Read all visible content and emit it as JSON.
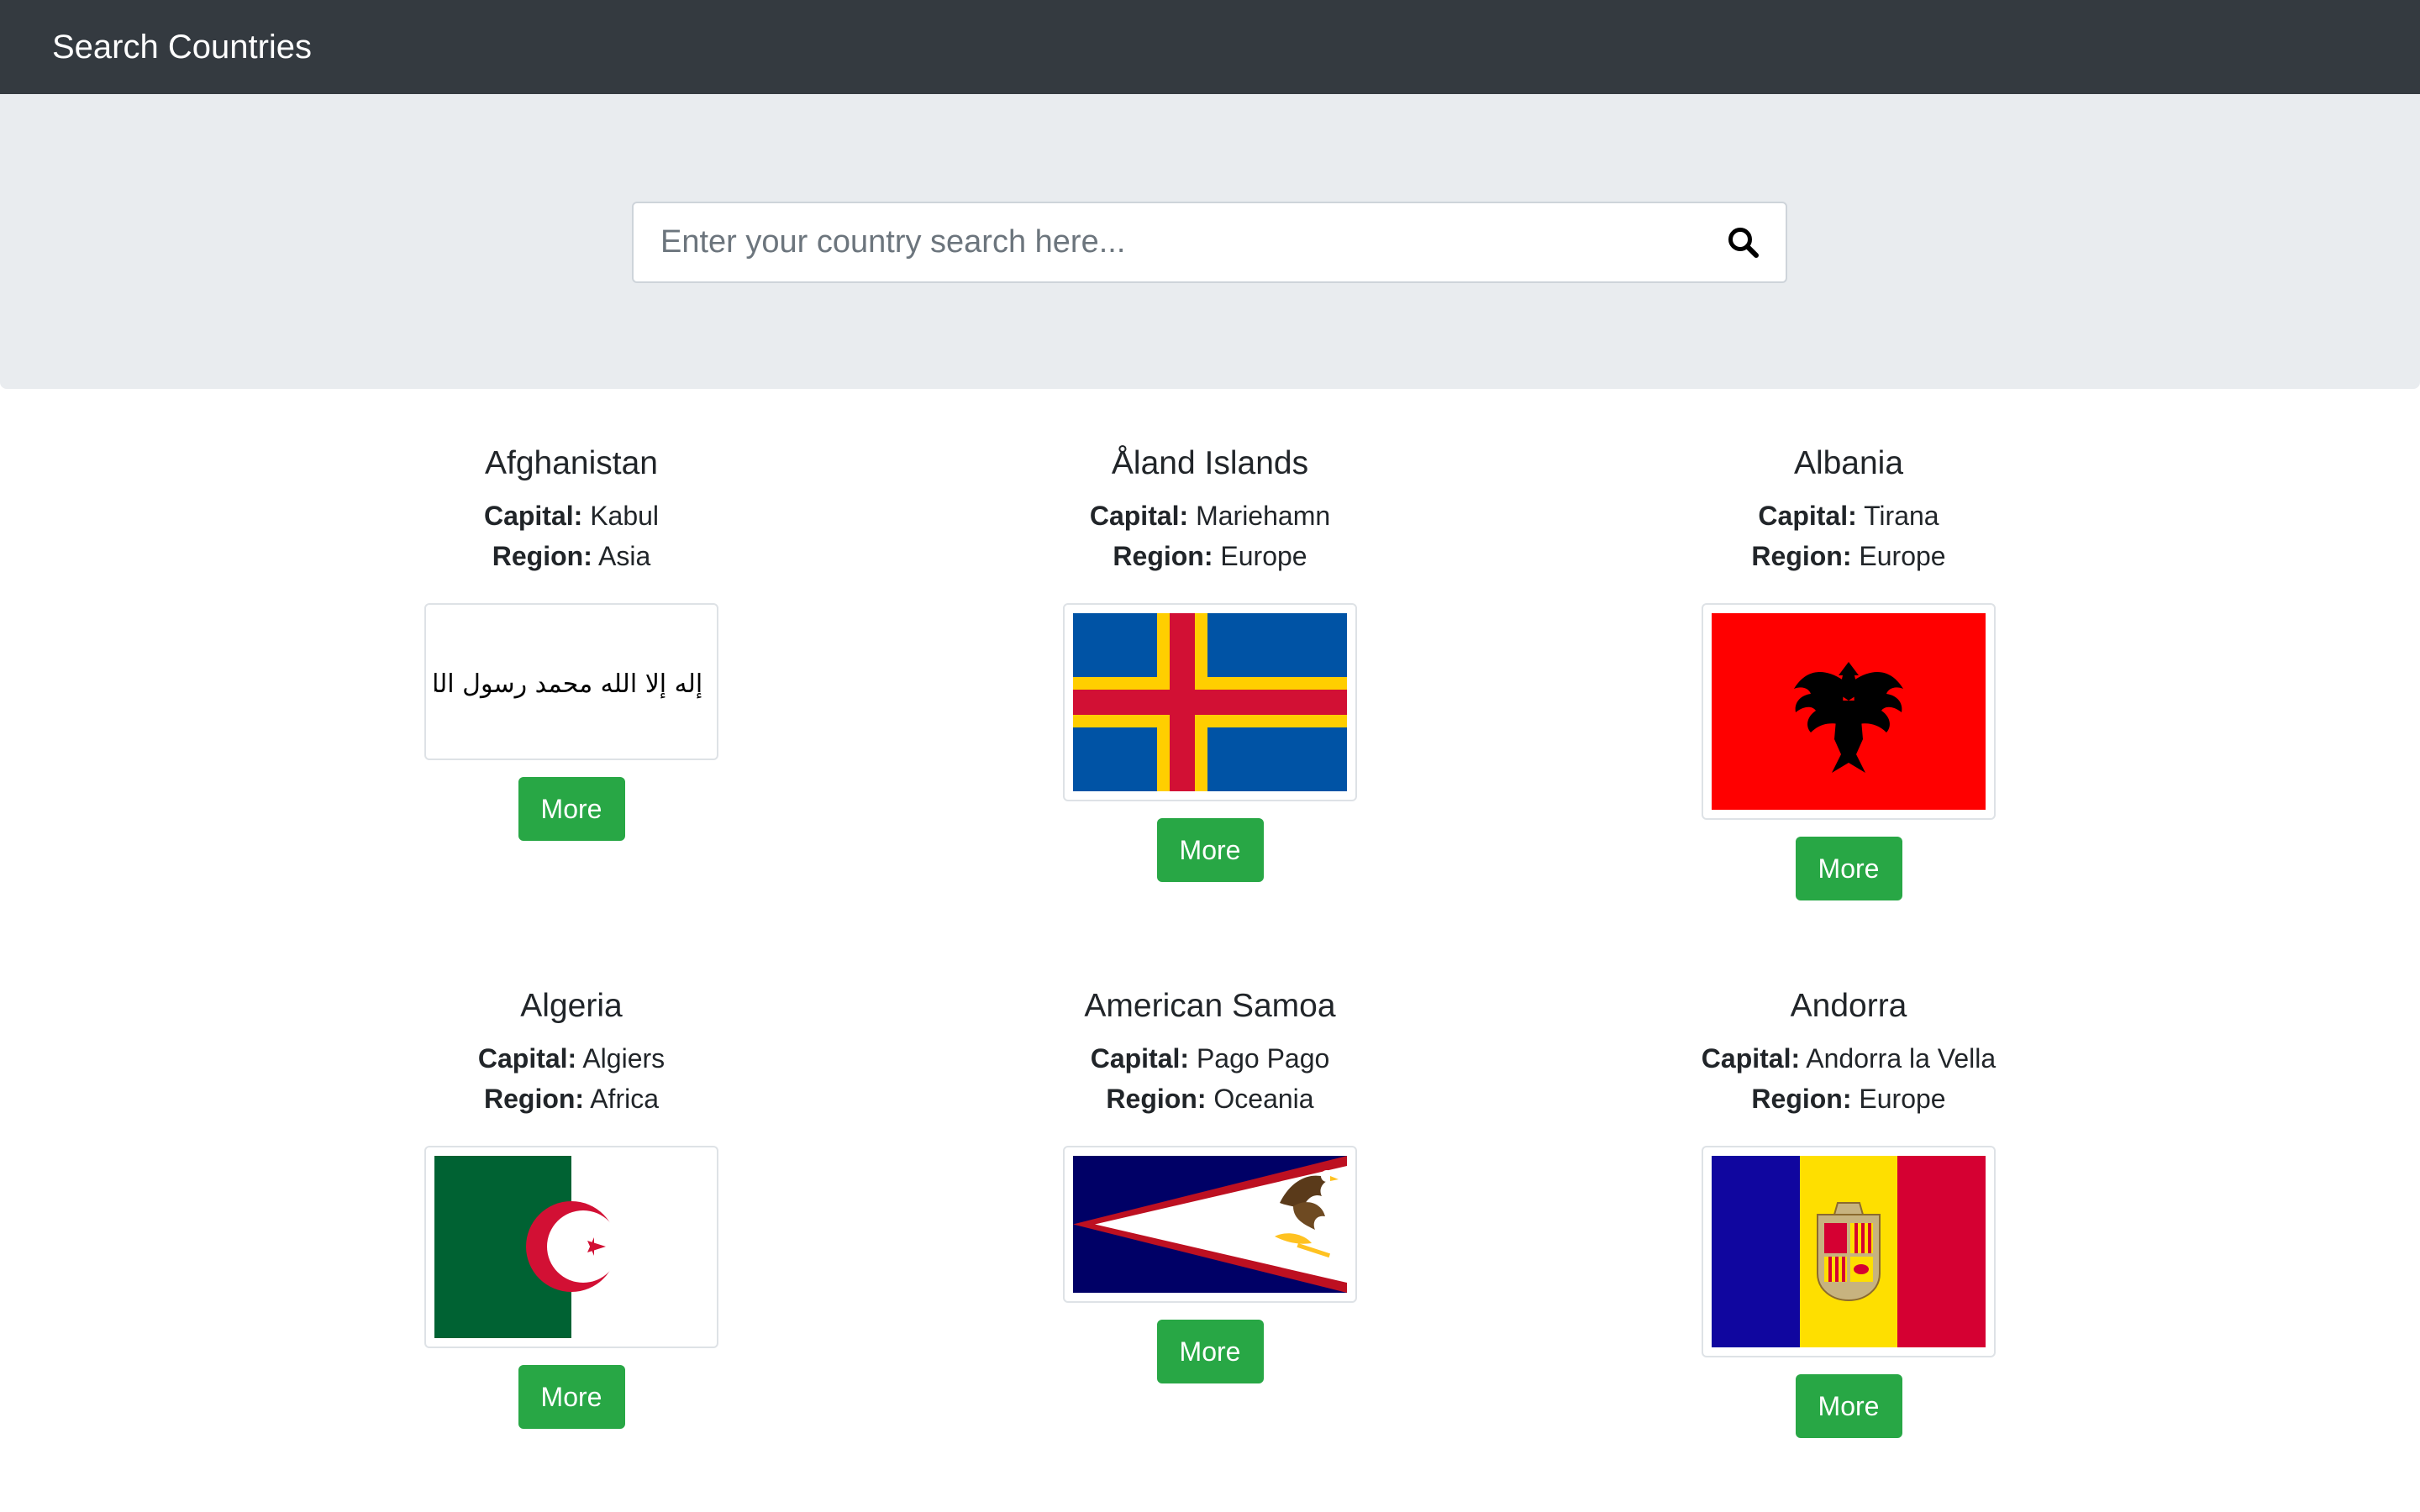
{
  "navbar": {
    "brand": "Search Countries"
  },
  "search": {
    "placeholder": "Enter your country search here...",
    "icon": "search-icon"
  },
  "labels": {
    "capital": "Capital:",
    "region": "Region:",
    "more": "More"
  },
  "countries": [
    {
      "name": "Afghanistan",
      "capital": "Kabul",
      "region": "Asia",
      "flag_inscription": "لا إله إلا الله محمد رسول الله"
    },
    {
      "name": "Åland Islands",
      "capital": "Mariehamn",
      "region": "Europe"
    },
    {
      "name": "Albania",
      "capital": "Tirana",
      "region": "Europe"
    },
    {
      "name": "Algeria",
      "capital": "Algiers",
      "region": "Africa"
    },
    {
      "name": "American Samoa",
      "capital": "Pago Pago",
      "region": "Oceania"
    },
    {
      "name": "Andorra",
      "capital": "Andorra la Vella",
      "region": "Europe"
    }
  ],
  "colors": {
    "navbar": "#343a40",
    "jumbotron": "#e9ecef",
    "button": "#28a745"
  }
}
